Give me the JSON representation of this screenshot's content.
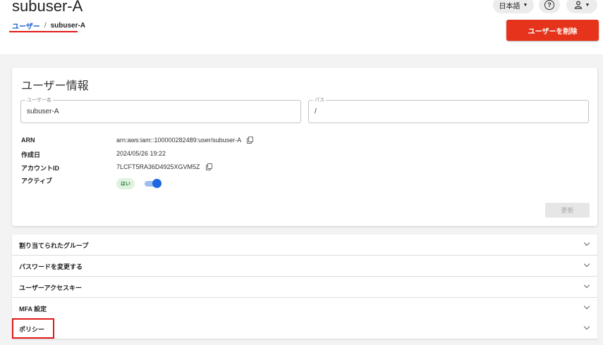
{
  "header": {
    "title": "subuser-A",
    "breadcrumb": {
      "parent": "ユーザー",
      "separator": "/",
      "current": "subuser-A"
    },
    "language": "日本語",
    "help_icon": "help-circle-icon",
    "user_icon": "person-icon",
    "delete_button": "ユーザーを削除"
  },
  "card": {
    "title": "ユーザー情報",
    "username": {
      "label": "ユーザー名",
      "value": "subuser-A"
    },
    "path": {
      "label": "パス",
      "value": "/"
    },
    "info": {
      "arn": {
        "label": "ARN",
        "value": "arn:aws:iam::100000282489:user/subuser-A"
      },
      "created": {
        "label": "作成日",
        "value": "2024/05/26 19:22"
      },
      "account_id": {
        "label": "アカウントID",
        "value": "7LCFT5RA36D4925XGVM5Z"
      },
      "active": {
        "label": "アクティブ",
        "badge": "はい",
        "toggle_on": true
      }
    },
    "update_button": "更新"
  },
  "sections": [
    {
      "label": "割り当てられたグループ"
    },
    {
      "label": "パスワードを変更する"
    },
    {
      "label": "ユーザーアクセスキー"
    },
    {
      "label": "MFA 設定"
    },
    {
      "label": "ポリシー"
    }
  ],
  "colors": {
    "accent": "#1f67e0",
    "danger": "#e5341b",
    "highlight": "#e01818",
    "badge_bg": "#dff4e0"
  }
}
